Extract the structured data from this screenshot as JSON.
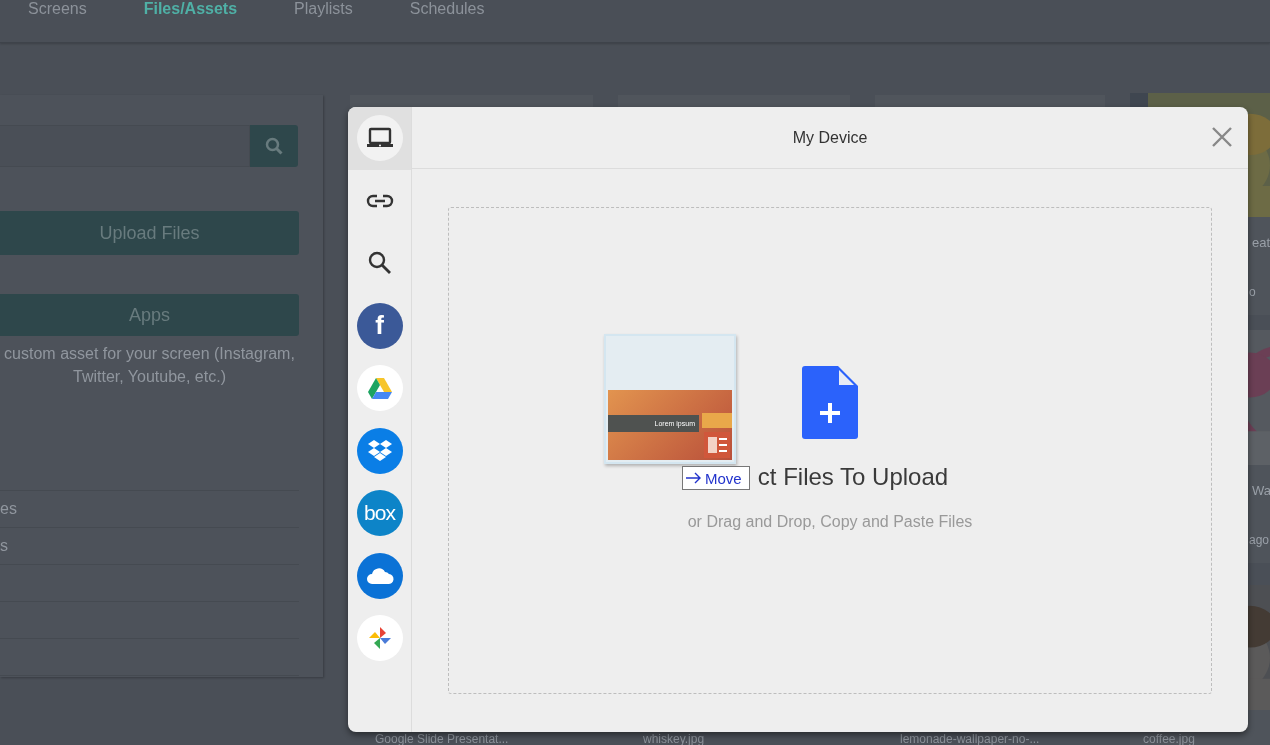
{
  "nav": {
    "tabs": [
      {
        "label": "Screens",
        "selected": false
      },
      {
        "label": "Files/Assets",
        "selected": true
      },
      {
        "label": "Playlists",
        "selected": false
      },
      {
        "label": "Schedules",
        "selected": false
      }
    ]
  },
  "left_panel": {
    "upload_button": "Upload Files",
    "apps_button": "Apps",
    "apps_description": "custom asset for your screen (Instagram, Twitter, Youtube, etc.)",
    "list_items": [
      "es",
      "s"
    ]
  },
  "grid": {
    "columns": [
      {
        "caption": "Google Slide Presentat..."
      },
      {
        "caption": "whiskey.jpg"
      },
      {
        "caption": "lemonade-wallpaper-no-..."
      }
    ],
    "right_column": [
      {
        "kind": "picture",
        "title": "eat",
        "meta": "o"
      },
      {
        "kind": "picture",
        "title": "Wa",
        "meta": "ago"
      },
      {
        "kind": "picture",
        "title": "coffee.jpg"
      }
    ]
  },
  "dialog": {
    "title": "My Device",
    "sources": [
      {
        "kind": "device",
        "selected": true
      },
      {
        "kind": "link",
        "selected": false
      },
      {
        "kind": "search",
        "selected": false
      },
      {
        "kind": "facebook",
        "label": "f",
        "selected": false
      },
      {
        "kind": "drive",
        "selected": false
      },
      {
        "kind": "dropbox",
        "selected": false
      },
      {
        "kind": "box",
        "label": "box",
        "selected": false
      },
      {
        "kind": "onedrive",
        "selected": false
      },
      {
        "kind": "photos",
        "selected": false
      }
    ],
    "dropzone": {
      "heading": "ct Files To Upload",
      "subtext": "or Drag and Drop, Copy and Paste Files"
    },
    "drag_preview": {
      "slide_title": "Lorem ipsum",
      "action": "Move"
    }
  }
}
